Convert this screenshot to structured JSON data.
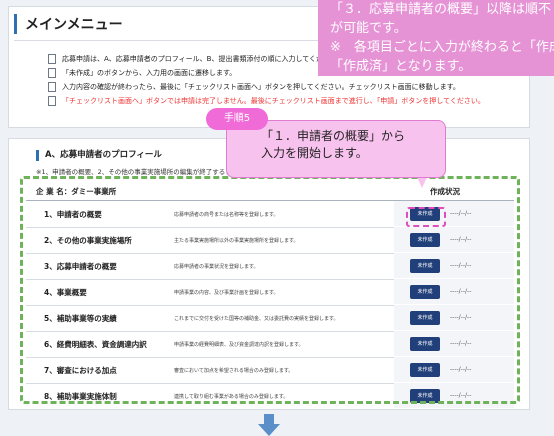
{
  "menu": {
    "title": "メインメニュー"
  },
  "notes": [
    "応募申請は、A、応募申請者のプロフィール、B、提出書類添付の順に入力してくださ",
    "「未作成」のボタンから、入力用の画面に遷移します。",
    "入力内容の確認が終わったら、最後に「チェックリスト画面へ」ボタンを押してください。チェックリスト画面に移動します。",
    "「チェックリスト画面へ」ボタンでは申請は完了しません。最後にチェックリスト画面まで進行し、「申請」ボタンを押してください。"
  ],
  "section": {
    "title": "A、応募申請者のプロフィール",
    "subtitle": "※1、申請者の概要、2、その他の事業実施場所の編集が終了すると、"
  },
  "table": {
    "company_label": "企 業 名：ダミー事業所",
    "status_header": "作成状況",
    "rows": [
      {
        "name": "1、申請者の概要",
        "desc": "応募申請者の商号または名称等を登録します。",
        "button": "未作成",
        "status": "----/--/--"
      },
      {
        "name": "2、その他の事業実施場所",
        "desc": "主たる事業実施場所以外の事業実施場所を登録します。",
        "button": "未作成",
        "status": "----/--/--"
      },
      {
        "name": "3、応募申請者の概要",
        "desc": "応募申請者の事業状況を登録します。",
        "button": "未作成",
        "status": "----/--/--"
      },
      {
        "name": "4、事業概要",
        "desc": "申請事業の内容、及び事業計画を登録します。",
        "button": "未作成",
        "status": "----/--/--"
      },
      {
        "name": "5、補助事業等の実績",
        "desc": "これまでに交付を受けた国等の補助金、又は委託費の実績を登録します。",
        "button": "未作成",
        "status": "----/--/--"
      },
      {
        "name": "6、経費明細表、資金調達内訳",
        "desc": "申請事業の経費明細表、及び資金調達内訳を登録します。",
        "button": "未作成",
        "status": "----/--/--"
      },
      {
        "name": "7、審査における加点",
        "desc": "審査において加点を希望される場合のみ登録します。",
        "button": "未作成",
        "status": "----/--/--"
      },
      {
        "name": "8、補助事業実施体制",
        "desc": "連携して取り組む事業がある場合のみ登録します。",
        "button": "未作成",
        "status": "----/--/--"
      }
    ]
  },
  "callout_top": {
    "lines": [
      "「３．応募申請者の概要」以降は順不",
      "が可能です。",
      "※　各項目ごとに入力が終わると「作成",
      "「作成済」となります。"
    ]
  },
  "step": {
    "label": "手順5",
    "text_line1": "「１．申請者の概要」から",
    "text_line2": "入力を開始します。"
  },
  "colors": {
    "accent": "#2f6fb4",
    "button": "#213f7a",
    "callout": "#e693d6",
    "dashed_green": "#6eb35a"
  }
}
